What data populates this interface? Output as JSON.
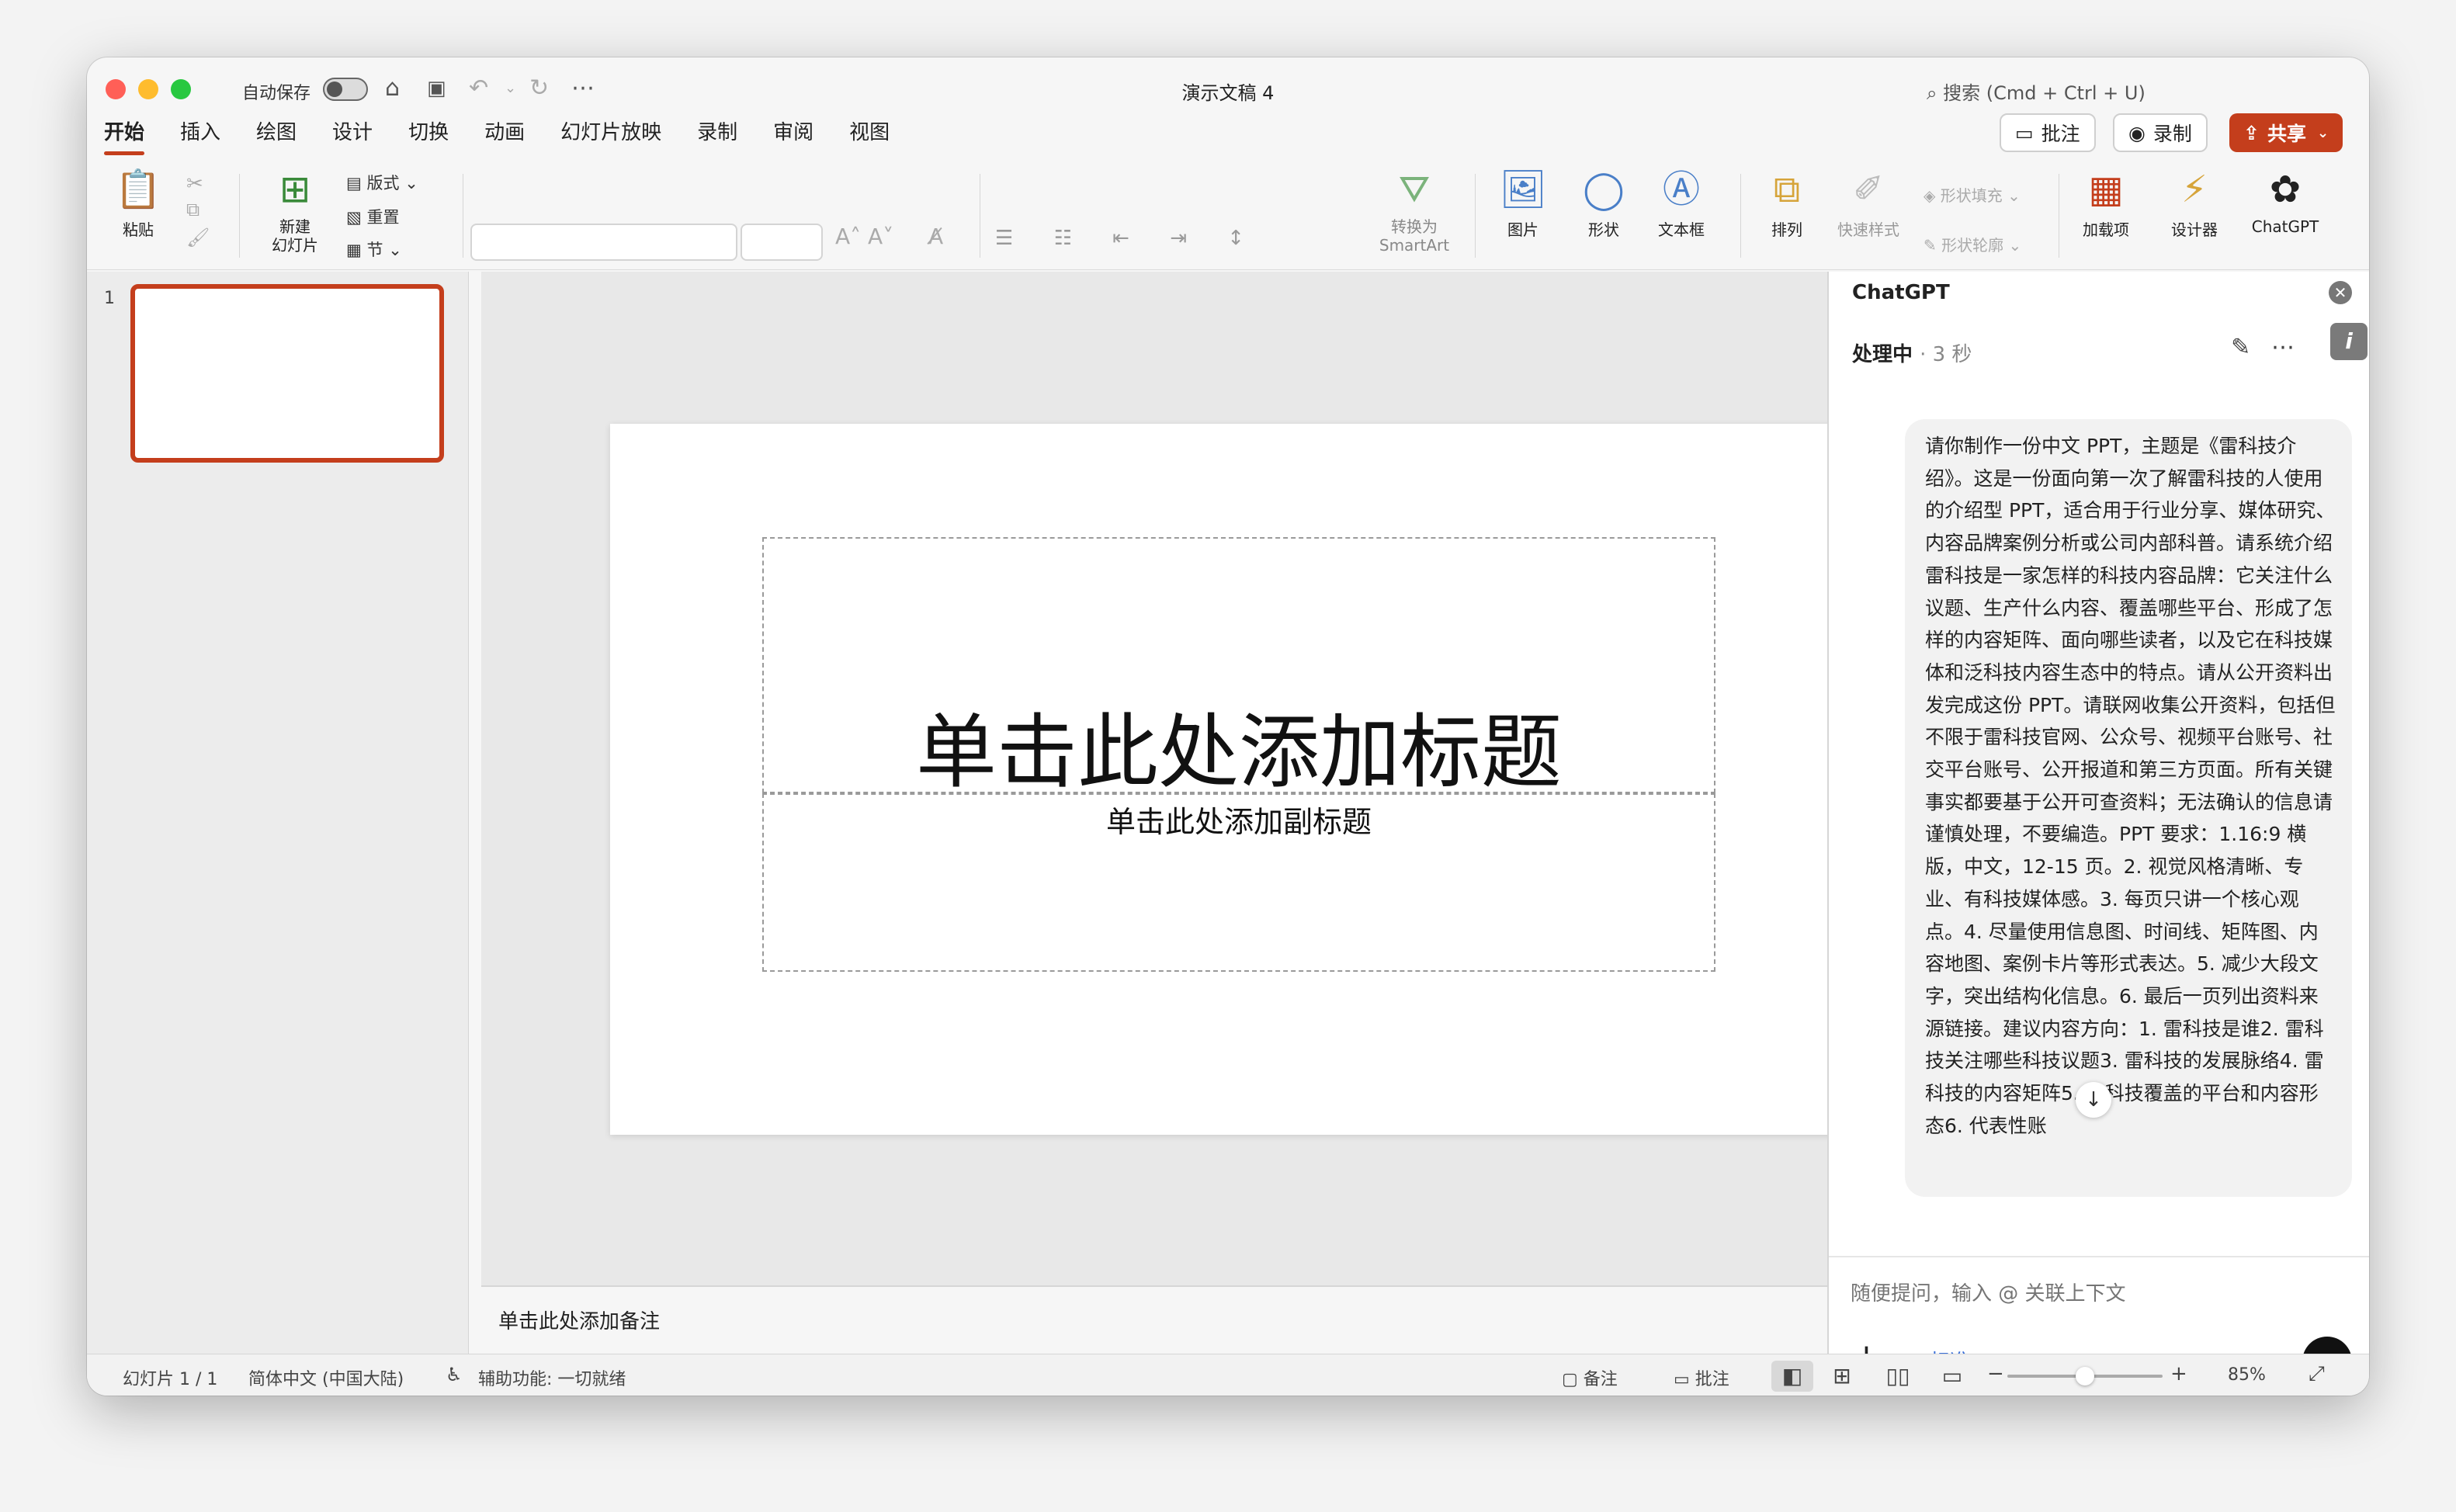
{
  "window": {
    "document_title": "演示文稿 4",
    "autosave_label": "自动保存"
  },
  "search": {
    "placeholder": "搜索 (Cmd + Ctrl + U)"
  },
  "tabs": [
    {
      "label": "开始"
    },
    {
      "label": "插入"
    },
    {
      "label": "绘图"
    },
    {
      "label": "设计"
    },
    {
      "label": "切换"
    },
    {
      "label": "动画"
    },
    {
      "label": "幻灯片放映"
    },
    {
      "label": "录制"
    },
    {
      "label": "审阅"
    },
    {
      "label": "视图"
    }
  ],
  "top_buttons": {
    "comment": "批注",
    "record": "录制",
    "share": "共享"
  },
  "ribbon": {
    "paste": "粘贴",
    "new_slide": "新建\n幻灯片",
    "layout": "版式",
    "reset": "重置",
    "section": "节",
    "convert_smartart": "转换为\nSmartArt",
    "picture": "图片",
    "shape": "形状",
    "textbox": "文本框",
    "arrange": "排列",
    "quick_styles": "快速样式",
    "shape_fill": "形状填充",
    "shape_outline": "形状轮廓",
    "addins": "加载项",
    "designer": "设计器",
    "chatgpt": "ChatGPT"
  },
  "thumbnails": {
    "slide_number": "1"
  },
  "slide": {
    "title_placeholder": "单击此处添加标题",
    "subtitle_placeholder": "单击此处添加副标题"
  },
  "notes": {
    "placeholder": "单击此处添加备注"
  },
  "chat_panel": {
    "title": "ChatGPT",
    "status": "处理中",
    "elapsed": "· 3 秒",
    "message": "请你制作一份中文 PPT，主题是《雷科技介绍》。这是一份面向第一次了解雷科技的人使用的介绍型 PPT，适合用于行业分享、媒体研究、内容品牌案例分析或公司内部科普。请系统介绍雷科技是一家怎样的科技内容品牌：它关注什么议题、生产什么内容、覆盖哪些平台、形成了怎样的内容矩阵、面向哪些读者，以及它在科技媒体和泛科技内容生态中的特点。请从公开资料出发完成这份 PPT。请联网收集公开资料，包括但不限于雷科技官网、公众号、视频平台账号、社交平台账号、公开报道和第三方页面。所有关键事实都要基于公开可查资料；无法确认的信息请谨慎处理，不要编造。PPT 要求：1.16:9 横版，中文，12-15 页。2. 视觉风格清晰、专业、有科技媒体感。3. 每页只讲一个核心观点。4. 尽量使用信息图、时间线、矩阵图、内容地图、案例卡片等形式表达。5. 减少大段文字，突出结构化信息。6. 最后一页列出资料来源链接。建议内容方向：1. 雷科技是谁2. 雷科技关注哪些科技议题3. 雷科技的发展脉络4. 雷科技的内容矩阵5. 雷科技覆盖的平台和内容形态6. 代表性账",
    "input_placeholder": "随便提问，输入 @ 关联上下文",
    "mode": "标准"
  },
  "status_bar": {
    "slide_count": "幻灯片 1 / 1",
    "language": "简体中文 (中国大陆)",
    "accessibility": "辅助功能: 一切就绪",
    "notes": "备注",
    "comments": "批注",
    "zoom": "85%",
    "zoom_level": 0.5
  },
  "colors": {
    "accent": "#c43e1c",
    "link": "#3a6fd8"
  }
}
